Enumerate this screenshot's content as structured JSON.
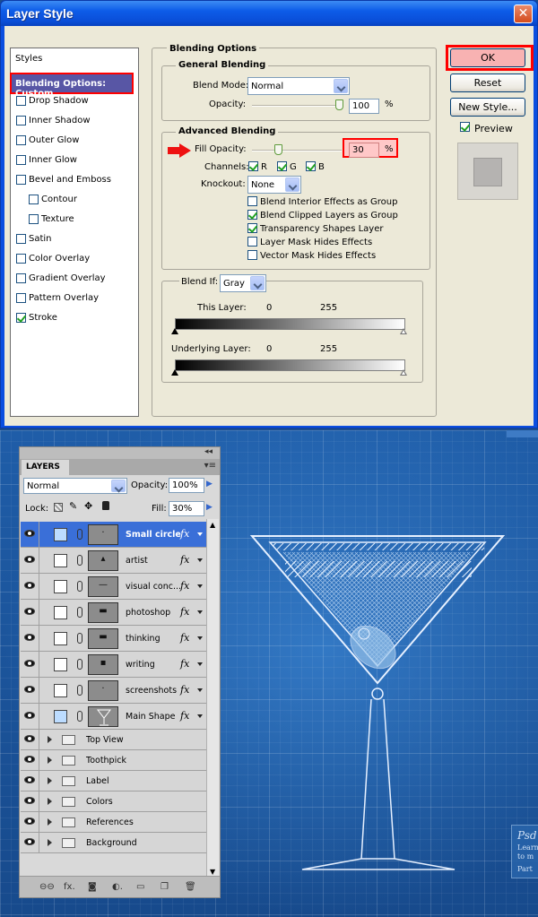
{
  "dialog": {
    "title": "Layer Style",
    "styles_heading": "Styles",
    "selected_style": "Blending Options: Custom",
    "style_items": [
      {
        "label": "Drop Shadow",
        "checked": false
      },
      {
        "label": "Inner Shadow",
        "checked": false
      },
      {
        "label": "Outer Glow",
        "checked": false
      },
      {
        "label": "Inner Glow",
        "checked": false
      },
      {
        "label": "Bevel and Emboss",
        "checked": false
      },
      {
        "label": "Contour",
        "checked": false
      },
      {
        "label": "Texture",
        "checked": false
      },
      {
        "label": "Satin",
        "checked": false
      },
      {
        "label": "Color Overlay",
        "checked": false
      },
      {
        "label": "Gradient Overlay",
        "checked": false
      },
      {
        "label": "Pattern Overlay",
        "checked": false
      },
      {
        "label": "Stroke",
        "checked": true
      }
    ],
    "blending_options": "Blending Options",
    "general_blending": "General Blending",
    "blend_mode_label": "Blend Mode:",
    "blend_mode_value": "Normal",
    "opacity_label": "Opacity:",
    "opacity_value": "100",
    "percent": "%",
    "advanced_blending": "Advanced Blending",
    "fill_opacity_label": "Fill Opacity:",
    "fill_opacity_value": "30",
    "channels_label": "Channels:",
    "channels": [
      "R",
      "G",
      "B"
    ],
    "knockout_label": "Knockout:",
    "knockout_value": "None",
    "advanced_options": [
      {
        "label": "Blend Interior Effects as Group",
        "checked": false
      },
      {
        "label": "Blend Clipped Layers as Group",
        "checked": true
      },
      {
        "label": "Transparency Shapes Layer",
        "checked": true
      },
      {
        "label": "Layer Mask Hides Effects",
        "checked": false
      },
      {
        "label": "Vector Mask Hides Effects",
        "checked": false
      }
    ],
    "blend_if_label": "Blend If:",
    "blend_if_value": "Gray",
    "this_layer_label": "This Layer:",
    "this_layer_min": "0",
    "this_layer_max": "255",
    "underlying_label": "Underlying Layer:",
    "underlying_min": "0",
    "underlying_max": "255",
    "ok": "OK",
    "reset": "Reset",
    "new_style": "New Style...",
    "preview": "Preview"
  },
  "layers": {
    "tab": "LAYERS",
    "blend_mode": "Normal",
    "opacity_label": "Opacity:",
    "opacity_value": "100%",
    "lock_label": "Lock:",
    "fill_label": "Fill:",
    "fill_value": "30%",
    "rows": [
      {
        "name": "Small circle",
        "selected": true
      },
      {
        "name": "artist",
        "selected": false
      },
      {
        "name": "visual conc...",
        "selected": false
      },
      {
        "name": "photoshop",
        "selected": false
      },
      {
        "name": "thinking",
        "selected": false
      },
      {
        "name": "writing",
        "selected": false
      },
      {
        "name": "screenshots",
        "selected": false
      },
      {
        "name": "Main Shape",
        "selected": false
      }
    ],
    "folders": [
      "Top View",
      "Toothpick",
      "Label",
      "Colors",
      "References",
      "Background"
    ],
    "fx": "fx",
    "bottom_icons": [
      "link-icon",
      "fx-icon",
      "mask-icon",
      "adjustment-icon",
      "folder-icon",
      "new-layer-icon",
      "trash-icon"
    ]
  },
  "badge": {
    "title": "Psd",
    "line1": "Learn",
    "line2": "to m",
    "part": "Part"
  }
}
